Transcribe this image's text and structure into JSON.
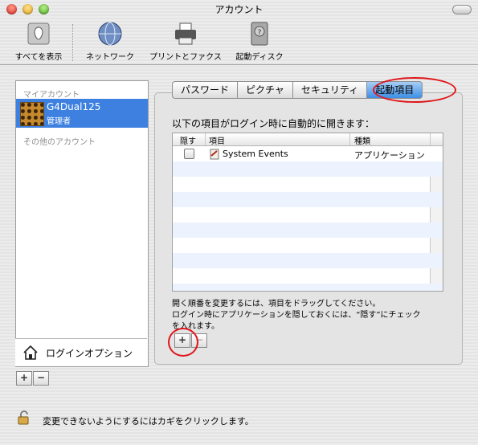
{
  "window": {
    "title": "アカウント"
  },
  "toolbar": {
    "items": [
      {
        "label": "すべてを表示",
        "icon": "show-all-icon"
      },
      {
        "label": "ネットワーク",
        "icon": "network-globe-icon"
      },
      {
        "label": "プリントとファクス",
        "icon": "printer-icon"
      },
      {
        "label": "起動ディスク",
        "icon": "hard-disk-icon"
      }
    ]
  },
  "sidebar": {
    "my_account_header": "マイアカウント",
    "selected_account": {
      "name": "G4Dual125",
      "role": "管理者"
    },
    "other_accounts_header": "その他のアカウント",
    "login_options": "ログインオプション",
    "add": "+",
    "remove": "−"
  },
  "tabs": [
    "パスワード",
    "ピクチャ",
    "セキュリティ",
    "起動項目"
  ],
  "selected_tab": "起動項目",
  "startup": {
    "heading": "以下の項目がログイン時に自動的に開きます：",
    "columns": {
      "hide": "隠す",
      "item": "項目",
      "kind": "種類"
    },
    "rows": [
      {
        "hidden": false,
        "item": "System Events",
        "kind": "アプリケーション"
      }
    ],
    "note1": "開く順番を変更するには、項目をドラッグしてください。",
    "note2": "ログイン時にアプリケーションを隠しておくには、“隠す”にチェック",
    "note3": "を入れます。",
    "add": "+",
    "remove": "−"
  },
  "lock_text": "変更できないようにするにはカギをクリックします。",
  "colors": {
    "selection": "#3d80df",
    "annotation": "#e0161a"
  }
}
